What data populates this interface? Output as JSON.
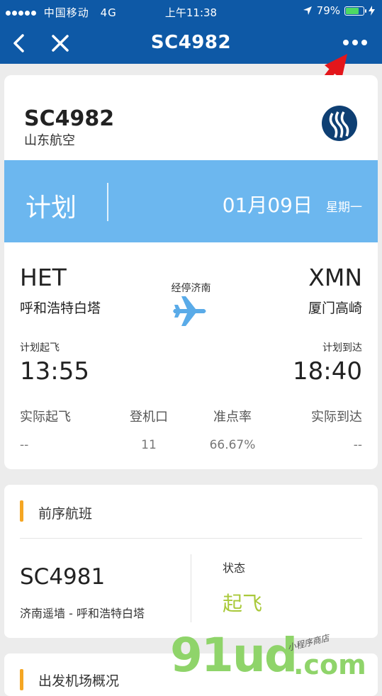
{
  "status_bar": {
    "carrier": "中国移动",
    "network": "4G",
    "time": "上午11:38",
    "battery": "79%",
    "battery_level": 0.79
  },
  "nav": {
    "title": "SC4982",
    "back_icon": "chevron-left-icon",
    "close_icon": "close-icon",
    "more_icon": "more-dots-icon"
  },
  "flight": {
    "number": "SC4982",
    "airline": "山东航空",
    "status": "计划",
    "date": "01月09日",
    "weekday": "星期一",
    "departure": {
      "code": "HET",
      "city": "呼和浩特白塔",
      "label": "计划起飞",
      "time": "13:55"
    },
    "arrival": {
      "code": "XMN",
      "city": "厦门高崎",
      "label": "计划到达",
      "time": "18:40"
    },
    "stopover": "经停济南",
    "band_color": "#6cb7ef"
  },
  "stats": [
    {
      "label": "实际起飞",
      "value": "--"
    },
    {
      "label": "登机口",
      "value": "11"
    },
    {
      "label": "准点率",
      "value": "66.67%"
    },
    {
      "label": "实际到达",
      "value": "--"
    }
  ],
  "previous_flight": {
    "section_title": "前序航班",
    "number": "SC4981",
    "route": "济南遥墙 - 呼和浩特白塔",
    "status_label": "状态",
    "status": "起飞",
    "status_color": "#a9c93a"
  },
  "next_section": {
    "title": "出发机场概况"
  },
  "watermark": {
    "main": "91ud",
    "suffix": ".com",
    "small": "小程序商店"
  },
  "colors": {
    "primary": "#0e59a6",
    "accent": "#f5a623"
  }
}
